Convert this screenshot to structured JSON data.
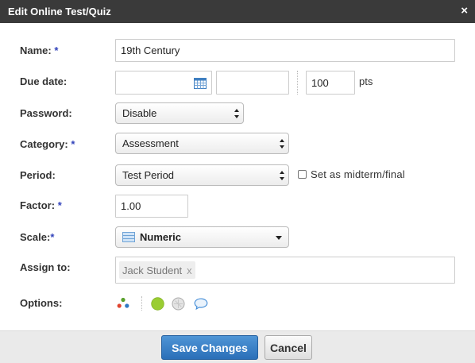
{
  "dialog": {
    "title": "Edit Online Test/Quiz",
    "close_glyph": "×"
  },
  "required_marker": "*",
  "fields": {
    "name": {
      "label": "Name:",
      "value": "19th Century"
    },
    "due_date": {
      "label": "Due date:",
      "date_value": "",
      "time_value": "",
      "points_value": "100",
      "points_unit": "pts"
    },
    "password": {
      "label": "Password:",
      "selected": "Disable"
    },
    "category": {
      "label": "Category:",
      "selected": "Assessment"
    },
    "period": {
      "label": "Period:",
      "selected": "Test Period",
      "midterm_label": "Set as midterm/final",
      "midterm_checked": false
    },
    "factor": {
      "label": "Factor:",
      "value": "1.00"
    },
    "scale": {
      "label": "Scale:",
      "selected": "Numeric"
    },
    "assign_to": {
      "label": "Assign to:",
      "chips": [
        "Jack Student"
      ],
      "chip_remove_glyph": "x"
    },
    "options": {
      "label": "Options:",
      "icons": [
        "resources-icon",
        "status-green-icon",
        "status-grey-icon",
        "comment-icon"
      ]
    }
  },
  "footer": {
    "save_label": "Save Changes",
    "cancel_label": "Cancel"
  },
  "colors": {
    "titlebar": "#3a3a3a",
    "primary": "#2f7ac4",
    "required": "#3344bb",
    "status_green": "#9acd32"
  }
}
